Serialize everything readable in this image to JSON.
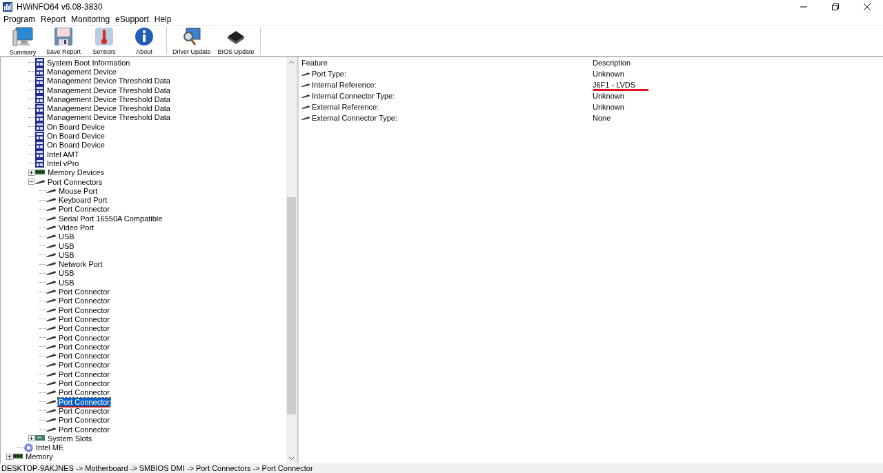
{
  "window": {
    "title": "HWiNFO64 v6.08-3830"
  },
  "menu": [
    "Program",
    "Report",
    "Monitoring",
    "eSupport",
    "Help"
  ],
  "toolbar": [
    {
      "label": "Summary",
      "kind": "monitor"
    },
    {
      "label": "Save Report",
      "kind": "disk"
    },
    {
      "label": "Sensors",
      "kind": "thermometer"
    },
    {
      "label": "About",
      "kind": "info"
    },
    {
      "label": "Driver Update",
      "kind": "driver",
      "group_start": true
    },
    {
      "label": "BIOS Update",
      "kind": "chip"
    }
  ],
  "tree": {
    "items": [
      {
        "children": [
          {
            "children": [
              {
                "label": "System Boot Information",
                "kind": "dmi",
                "selected": false
              },
              {
                "label": "Management Device",
                "kind": "dmi",
                "selected": false
              },
              {
                "label": "Management Device Threshold Data",
                "kind": "dmi",
                "selected": false
              },
              {
                "label": "Management Device Threshold Data",
                "kind": "dmi",
                "selected": false
              },
              {
                "label": "Management Device Threshold Data",
                "kind": "dmi",
                "selected": false
              },
              {
                "label": "Management Device Threshold Data",
                "kind": "dmi",
                "selected": false
              },
              {
                "label": "Management Device Threshold Data",
                "kind": "dmi",
                "selected": false
              },
              {
                "label": "On Board Device",
                "kind": "dmi",
                "selected": false
              },
              {
                "label": "On Board Device",
                "kind": "dmi",
                "selected": false
              },
              {
                "label": "On Board Device",
                "kind": "dmi",
                "selected": false
              },
              {
                "label": "Intel AMT",
                "kind": "dmi",
                "selected": false
              },
              {
                "label": "Intel vPro",
                "kind": "dmi",
                "selected": false
              },
              {
                "label": "Memory Devices",
                "kind": "memory",
                "expanded": false,
                "selected": false
              },
              {
                "label": "Port Connectors",
                "kind": "port",
                "expanded": true,
                "selected": false,
                "children": [
                  {
                    "label": "Mouse Port",
                    "kind": "port",
                    "selected": false
                  },
                  {
                    "label": "Keyboard Port",
                    "kind": "port",
                    "selected": false
                  },
                  {
                    "label": "Port Connector",
                    "kind": "port",
                    "selected": false
                  },
                  {
                    "label": "Serial Port 16550A Compatible",
                    "kind": "port",
                    "selected": false
                  },
                  {
                    "label": "Video Port",
                    "kind": "port",
                    "selected": false
                  },
                  {
                    "label": "USB",
                    "kind": "port",
                    "selected": false
                  },
                  {
                    "label": "USB",
                    "kind": "port",
                    "selected": false
                  },
                  {
                    "label": "USB",
                    "kind": "port",
                    "selected": false
                  },
                  {
                    "label": "Network Port",
                    "kind": "port",
                    "selected": false
                  },
                  {
                    "label": "USB",
                    "kind": "port",
                    "selected": false
                  },
                  {
                    "label": "USB",
                    "kind": "port",
                    "selected": false
                  },
                  {
                    "label": "Port Connector",
                    "kind": "port",
                    "selected": false
                  },
                  {
                    "label": "Port Connector",
                    "kind": "port",
                    "selected": false
                  },
                  {
                    "label": "Port Connector",
                    "kind": "port",
                    "selected": false
                  },
                  {
                    "label": "Port Connector",
                    "kind": "port",
                    "selected": false
                  },
                  {
                    "label": "Port Connector",
                    "kind": "port",
                    "selected": false
                  },
                  {
                    "label": "Port Connector",
                    "kind": "port",
                    "selected": false
                  },
                  {
                    "label": "Port Connector",
                    "kind": "port",
                    "selected": false
                  },
                  {
                    "label": "Port Connector",
                    "kind": "port",
                    "selected": false
                  },
                  {
                    "label": "Port Connector",
                    "kind": "port",
                    "selected": false
                  },
                  {
                    "label": "Port Connector",
                    "kind": "port",
                    "selected": false
                  },
                  {
                    "label": "Port Connector",
                    "kind": "port",
                    "selected": false
                  },
                  {
                    "label": "Port Connector",
                    "kind": "port",
                    "selected": false
                  },
                  {
                    "label": "Port Connector",
                    "kind": "port",
                    "selected": true,
                    "underlined": true
                  },
                  {
                    "label": "Port Connector",
                    "kind": "port",
                    "selected": false
                  },
                  {
                    "label": "Port Connector",
                    "kind": "port",
                    "selected": false
                  },
                  {
                    "label": "Port Connector",
                    "kind": "port",
                    "selected": false
                  }
                ]
              },
              {
                "label": "System Slots",
                "kind": "slots",
                "expanded": false,
                "selected": false
              }
            ]
          },
          {
            "label": "Intel ME",
            "kind": "me",
            "selected": false
          }
        ]
      },
      {
        "label": "Memory",
        "kind": "memory",
        "expanded": false,
        "selected": false
      }
    ]
  },
  "details": {
    "columns": [
      "Feature",
      "Description"
    ],
    "rows": [
      {
        "feature": "Port Type:",
        "description": "Unknown"
      },
      {
        "feature": "Internal Reference:",
        "description": "J6F1 - LVDS",
        "underlined": true
      },
      {
        "feature": "Internal Connector Type:",
        "description": "Unknown"
      },
      {
        "feature": "External Reference:",
        "description": "Unknown"
      },
      {
        "feature": "External Connector Type:",
        "description": "None"
      }
    ]
  },
  "status_bar": "DESKTOP-9AKJNES -> Motherboard -> SMBIOS DMI -> Port Connectors -> Port Connector"
}
